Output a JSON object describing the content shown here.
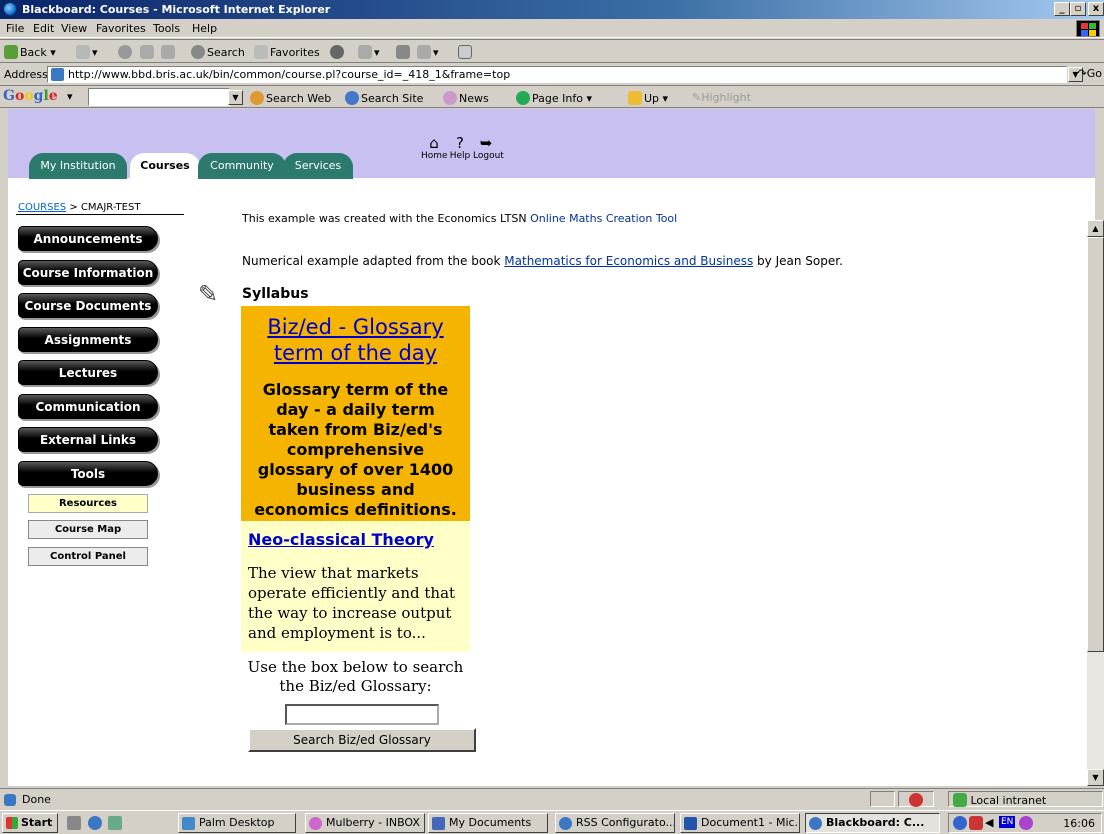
{
  "window": {
    "title": "Blackboard: Courses - Microsoft Internet Explorer",
    "buttons": {
      "minimize": "_",
      "maximize": "▫",
      "close": "x"
    }
  },
  "menubar": [
    "File",
    "Edit",
    "View",
    "Favorites",
    "Tools",
    "Help"
  ],
  "toolbar": {
    "back": "Back",
    "search": "Search",
    "favorites": "Favorites"
  },
  "address": {
    "label": "Address",
    "url": "http://www.bbd.bris.ac.uk/bin/common/course.pl?course_id=_418_1&frame=top",
    "go": "Go"
  },
  "google_bar": {
    "logo": "Google",
    "search_web": "Search Web",
    "search_site": "Search Site",
    "news": "News",
    "page_info": "Page Info",
    "up": "Up",
    "highlight": "Highlight"
  },
  "bb_header": {
    "tabs": [
      "My Institution",
      "Courses",
      "Community",
      "Services"
    ],
    "active_tab": "Courses",
    "icons": [
      {
        "label": "Home",
        "icon": "home-icon"
      },
      {
        "label": "Help",
        "icon": "help-icon"
      },
      {
        "label": "Logout",
        "icon": "logout-icon"
      }
    ]
  },
  "breadcrumb": {
    "root": "COURSES",
    "separator": ">",
    "current": "CMAJR-TEST"
  },
  "course_menu": {
    "items": [
      "Announcements",
      "Course Information",
      "Course Documents",
      "Assignments",
      "Lectures",
      "Communication",
      "External Links",
      "Tools"
    ],
    "sub_buttons": [
      "Resources",
      "Course Map",
      "Control Panel"
    ],
    "highlighted_sub": "Resources"
  },
  "content": {
    "cut_line": "This example was created with the Economics LTSN",
    "cut_link": "Online Maths Creation Tool",
    "numerical_prefix": "Numerical example adapted from the book",
    "book_link": "Mathematics for Economics and Business",
    "numerical_suffix": "by Jean Soper.",
    "section_title": "Syllabus",
    "glossary_link": "Biz/ed - Glossary term of the day",
    "glossary_desc": "Glossary term of the day - a daily term taken from Biz/ed's comprehensive glossary of over 1400 business and economics definitions.",
    "term_link": "Neo-classical Theory",
    "term_def": "The view that markets operate efficiently and that the way to increase output and employment is to...",
    "search_label": "Use the box below to search the Biz/ed Glossary:",
    "search_value": "",
    "search_button": "Search Biz/ed Glossary"
  },
  "statusbar": {
    "status": "Done",
    "zone": "Local intranet"
  },
  "taskbar": {
    "start": "Start",
    "tasks": [
      "Palm Desktop",
      "Mulberry - INBOX",
      "My Documents",
      "RSS Configurato...",
      "Document1 - Mic...",
      "Blackboard: C..."
    ],
    "active_task": "Blackboard: C...",
    "tray_lang": "EN",
    "clock": "16:06"
  },
  "colors": {
    "title_bar": "#0a246a",
    "bb_header": "#c8c0f0",
    "tab_green": "#2c7a6e",
    "glossary_orange": "#f5b400",
    "glossary_yellow": "#ffffc8",
    "link": "#0000cc"
  }
}
